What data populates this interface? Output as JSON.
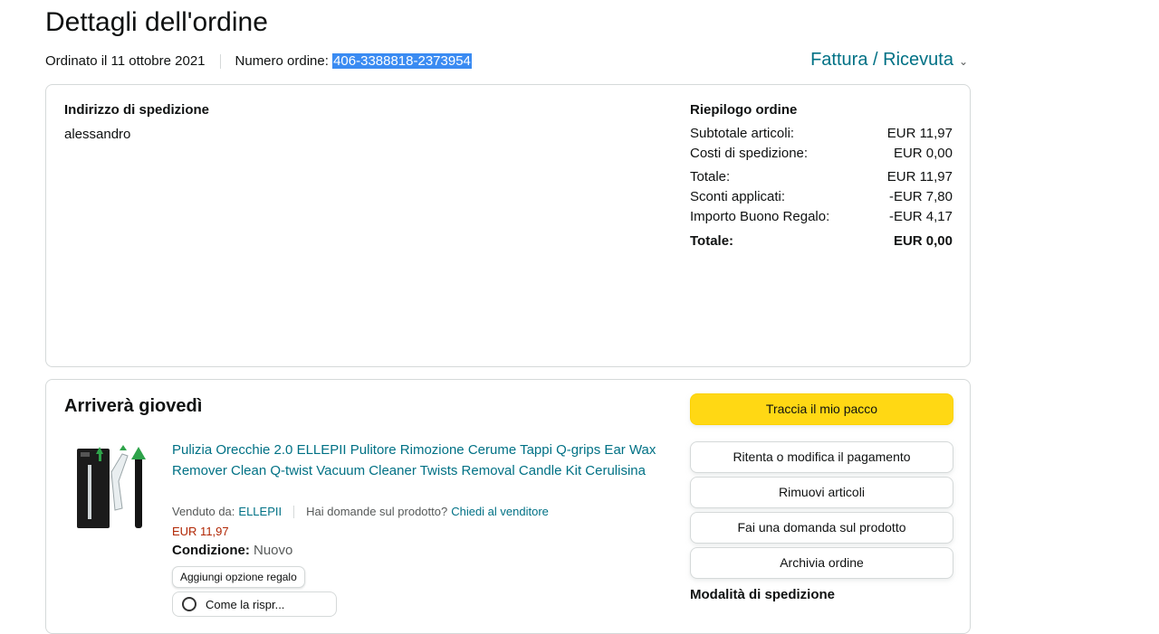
{
  "page": {
    "title": "Dettagli dell'ordine",
    "ordered_on": "Ordinato il 11 ottobre 2021",
    "order_number_label": "Numero ordine:",
    "order_number": "406-3388818-2373954",
    "invoice_label": "Fattura / Ricevuta",
    "invoice_chevron": "⌄"
  },
  "shipping": {
    "heading": "Indirizzo di spedizione",
    "name": "alessandro"
  },
  "summary": {
    "heading": "Riepilogo ordine",
    "rows": [
      {
        "label": "Subtotale articoli:",
        "value": "EUR 11,97"
      },
      {
        "label": "Costi di spedizione:",
        "value": "EUR 0,00"
      },
      {
        "label": "Totale:",
        "value": "EUR 11,97"
      },
      {
        "label": "Sconti applicati:",
        "value": "-EUR 7,80"
      },
      {
        "label": "Importo Buono Regalo:",
        "value": "-EUR 4,17"
      }
    ],
    "grand_total_label": "Totale:",
    "grand_total_value": "EUR 0,00"
  },
  "shipment": {
    "status": "Arriverà giovedì",
    "product_title": "Pulizia Orecchie 2.0 ELLEPII Pulitore Rimozione Cerume Tappi Q-grips Ear Wax Remover Clean Q-twist Vacuum Cleaner Twists Removal Candle Kit Cerulisina",
    "sold_by_label": "Venduto da:",
    "seller": "ELLEPII",
    "question_text": "Hai domande sul prodotto?",
    "question_link": "Chiedi al venditore",
    "price": "EUR 11,97",
    "condition_label": "Condizione:",
    "condition_value": "Nuovo",
    "gift_button": "Aggiungi opzione regalo",
    "extra_button": "Come la rispr..."
  },
  "actions": {
    "track": "Traccia il mio pacco",
    "retry_payment": "Ritenta o modifica il pagamento",
    "remove_items": "Rimuovi articoli",
    "ask_question": "Fai una domanda sul prodotto",
    "archive": "Archivia ordine",
    "shipping_mode_heading": "Modalità di spedizione"
  },
  "colors": {
    "link": "#007185",
    "primary_button": "#ffd814",
    "price": "#b12704",
    "selection": "#3a8bf2"
  }
}
